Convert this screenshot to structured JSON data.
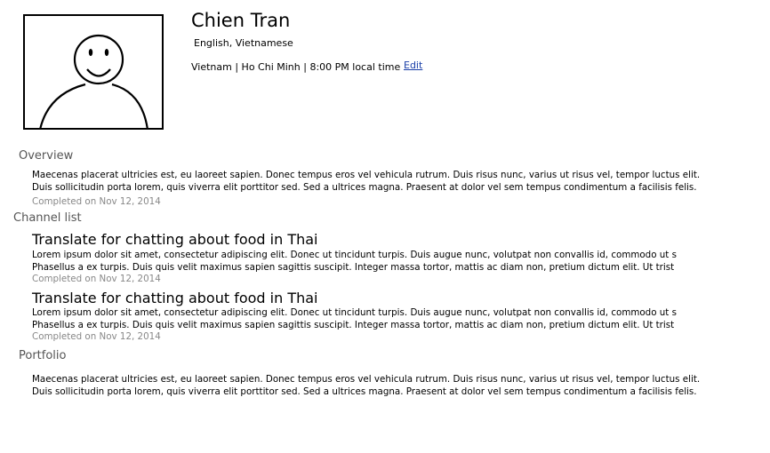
{
  "profile": {
    "name": "Chien Tran",
    "languages": "English, Vietnamese",
    "location": "Vietnam | Ho Chi Minh | 8:00 PM local time",
    "edit_label": "Edit",
    "avatar_icon": "user-avatar-icon"
  },
  "overview": {
    "heading": "Overview",
    "lines": [
      "Maecenas placerat ultricies est, eu laoreet sapien. Donec tempus eros vel vehicula rutrum. Duis risus nunc, varius ut risus vel, tempor luctus elit.",
      "Duis sollicitudin porta lorem, quis viverra elit porttitor sed. Sed a ultrices magna. Praesent at dolor vel sem tempus condimentum a facilisis felis."
    ],
    "completed": "Completed on Nov 12, 2014"
  },
  "channels": {
    "heading": "Channel list",
    "items": [
      {
        "title": "Translate for chatting about food in Thai",
        "lines": [
          "Lorem ipsum dolor sit amet, consectetur adipiscing elit. Donec ut tincidunt turpis. Duis augue nunc, volutpat non convallis id, commodo ut s",
          "Phasellus a ex turpis. Duis quis velit maximus sapien sagittis suscipit. Integer massa tortor, mattis ac diam non, pretium dictum elit. Ut trist"
        ],
        "completed": "Completed on Nov 12, 2014"
      },
      {
        "title": "Translate for chatting about food in Thai",
        "lines": [
          "Lorem ipsum dolor sit amet, consectetur adipiscing elit. Donec ut tincidunt turpis. Duis augue nunc, volutpat non convallis id, commodo ut s",
          "Phasellus a ex turpis. Duis quis velit maximus sapien sagittis suscipit. Integer massa tortor, mattis ac diam non, pretium dictum elit. Ut trist"
        ],
        "completed": "Completed on Nov 12, 2014"
      }
    ]
  },
  "portfolio": {
    "heading": "Portfolio",
    "lines": [
      "Maecenas placerat ultricies est, eu laoreet sapien. Donec tempus eros vel vehicula rutrum. Duis risus nunc, varius ut risus vel, tempor luctus elit.",
      "Duis sollicitudin porta lorem, quis viverra elit porttitor sed. Sed a ultrices magna. Praesent at dolor vel sem tempus condimentum a facilisis felis."
    ]
  },
  "colors": {
    "link": "#1a3fa8",
    "heading": "#555555",
    "meta": "#888888"
  }
}
